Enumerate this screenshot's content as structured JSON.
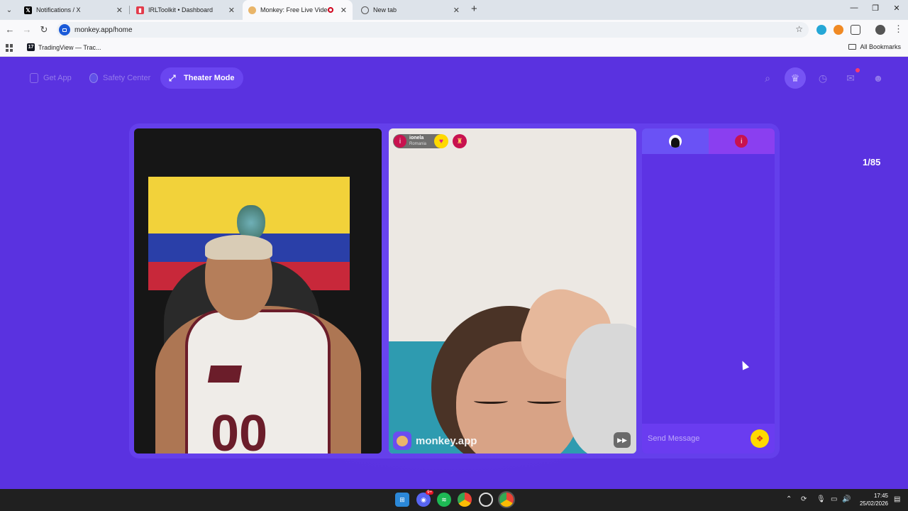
{
  "browser": {
    "tabs": [
      {
        "title": "Notifications / X",
        "active": false
      },
      {
        "title": "IRLToolkit • Dashboard",
        "active": false
      },
      {
        "title": "Monkey: Free Live Video Ch",
        "active": true
      },
      {
        "title": "New tab",
        "active": false
      }
    ],
    "url": "monkey.app/home",
    "bookmarks": [
      {
        "label": "TradingView — Trac..."
      }
    ],
    "all_bookmarks_label": "All Bookmarks"
  },
  "page": {
    "nav": {
      "get_app": "Get App",
      "safety_center": "Safety Center",
      "theater_mode": "Theater Mode"
    },
    "counter": "1/85",
    "peer": {
      "name": "ionela",
      "country": "Romania",
      "info_glyph": "i"
    },
    "watermark": "monkey.app",
    "chat": {
      "placeholder": "Send Message"
    }
  },
  "taskbar": {
    "time": "17:45",
    "date": "25/02/2026",
    "discord_badge": "9+"
  },
  "colors": {
    "brand_purple": "#5a32e0",
    "accent_pink": "#c8124f",
    "accent_yellow": "#ffd900"
  }
}
